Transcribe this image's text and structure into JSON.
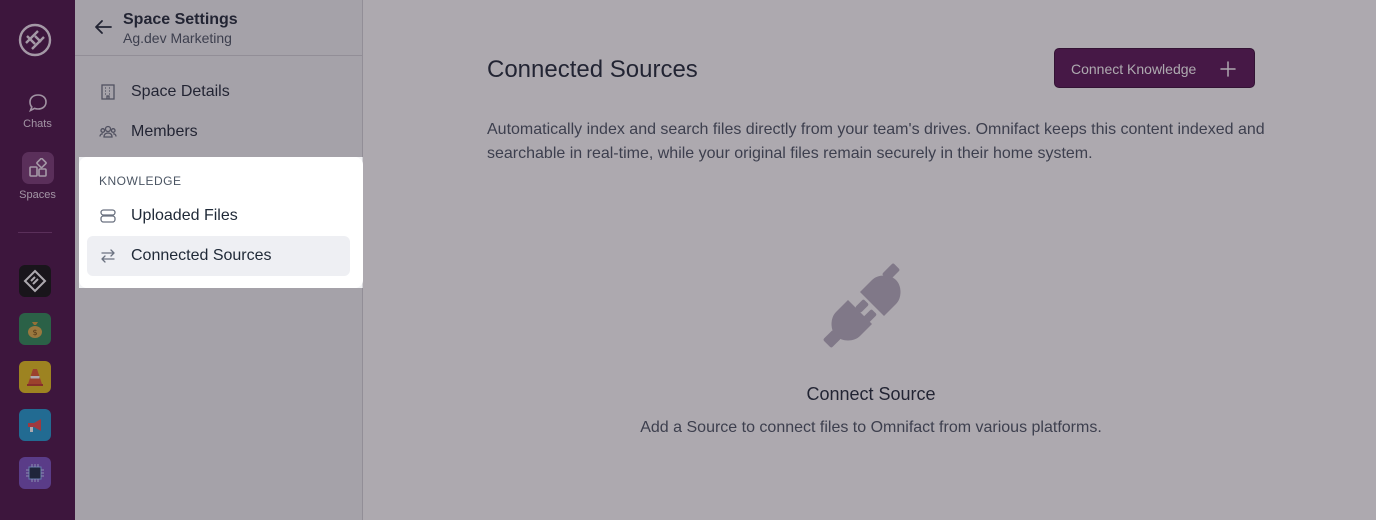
{
  "rail": {
    "chats_label": "Chats",
    "spaces_label": "Spaces",
    "apps": [
      {
        "name": "app-diamond-icon",
        "color": "#111111"
      },
      {
        "name": "money-bag-icon",
        "color": "#2e8b57"
      },
      {
        "name": "traffic-cone-icon",
        "color": "#e5c21a"
      },
      {
        "name": "megaphone-icon",
        "color": "#1f9bd1"
      },
      {
        "name": "chip-icon",
        "color": "#7a4fc0"
      }
    ]
  },
  "sidebar": {
    "title": "Space Settings",
    "subtitle": "Ag.dev Marketing",
    "items": [
      {
        "label": "Space Details"
      },
      {
        "label": "Members"
      }
    ],
    "knowledge": {
      "section_label": "KNOWLEDGE",
      "items": [
        {
          "label": "Uploaded Files"
        },
        {
          "label": "Connected Sources"
        }
      ]
    }
  },
  "main": {
    "title": "Connected Sources",
    "connect_button": "Connect Knowledge",
    "description": "Automatically index and search files directly from your team's drives. Omnifact keeps this content indexed and searchable in real-time, while your original files remain securely in their home system.",
    "empty": {
      "title": "Connect Source",
      "text": "Add a Source to connect files to Omnifact from various platforms."
    }
  },
  "colors": {
    "rail": "#4b1248",
    "accent": "#5a1556"
  }
}
